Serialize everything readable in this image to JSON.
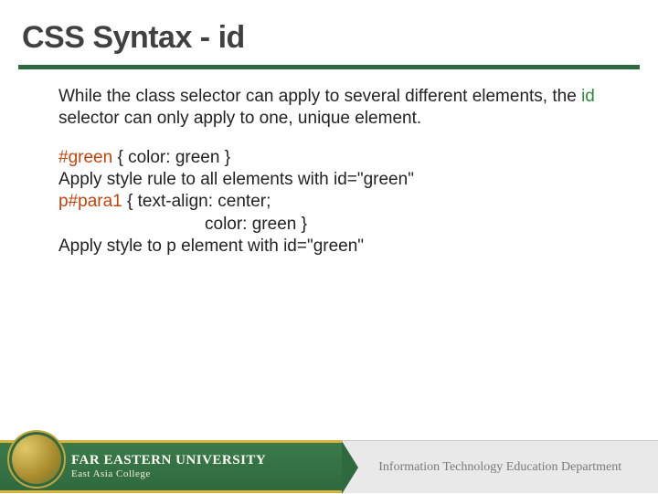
{
  "title": "CSS Syntax - id",
  "para1_a": "While the class selector can apply to several different elements, the ",
  "para1_id": "id",
  "para1_b": " selector can only apply to one, unique element.",
  "code": {
    "l1_sel": "#green",
    "l1_rest": " { color: green }",
    "l2": "Apply style rule to all elements with id=\"green\"",
    "l3_sel": "p#para1",
    "l3_rest": " { text-align: center;",
    "l4": "color: green }",
    "l5": "Apply style to p element with id=\"green\""
  },
  "footer": {
    "university": "FAR EASTERN UNIVERSITY",
    "college": "East Asia College",
    "department": "Information Technology Education Department"
  }
}
